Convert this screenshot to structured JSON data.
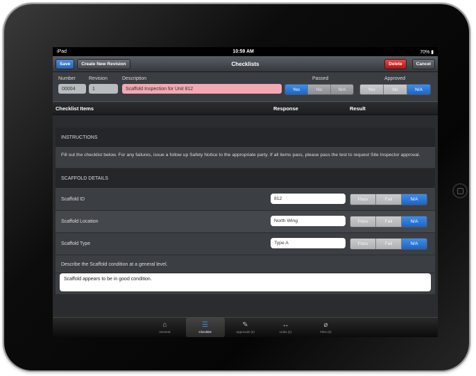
{
  "status_bar": {
    "carrier": "iPad",
    "time": "10:59 AM",
    "battery": "70%"
  },
  "nav": {
    "save_label": "Save",
    "create_revision_label": "Create New Revision",
    "title": "Checklists",
    "delete_label": "Delete",
    "cancel_label": "Cancel"
  },
  "header": {
    "number_label": "Number",
    "revision_label": "Revision",
    "description_label": "Description",
    "passed_label": "Passed",
    "approved_label": "Approved",
    "number_value": "00004",
    "revision_value": "1",
    "description_value": "Scaffold Inspection for Unit 812",
    "passed_options": [
      "Yes",
      "No",
      "N/A"
    ],
    "passed_selected": "Yes",
    "approved_options": [
      "Yes",
      "No",
      "N/A"
    ],
    "approved_selected": "N/A"
  },
  "columns": {
    "items": "Checklist Items",
    "response": "Response",
    "result": "Result"
  },
  "instructions": {
    "heading": "INSTRUCTIONS",
    "text": "Fill out the checklist below. For any failures, issue a follow up Safety Notice to the appropriate party. If all items pass, please pass the test to request Site Inspector approval."
  },
  "scaffold_section": {
    "heading": "SCAFFOLD DETAILS",
    "items": [
      {
        "name": "Scaffold ID",
        "value": "812",
        "options": [
          "Pass",
          "Fail",
          "N/A"
        ],
        "selected": "N/A"
      },
      {
        "name": "Scaffold Location",
        "value": "North Wing",
        "options": [
          "Pass",
          "Fail",
          "N/A"
        ],
        "selected": "N/A"
      },
      {
        "name": "Scaffold Type",
        "value": "Type A",
        "options": [
          "Pass",
          "Fail",
          "N/A"
        ],
        "selected": "N/A"
      }
    ],
    "describe_prompt": "Describe the Scaffold condition at a general level.",
    "describe_value": "Scaffold appears to be in good condition."
  },
  "tabs": [
    {
      "label": "General",
      "icon": "home-icon"
    },
    {
      "label": "Checklist",
      "icon": "list-icon",
      "active": true
    },
    {
      "label": "Approvals (2)",
      "icon": "pencil-icon"
    },
    {
      "label": "Links (1)",
      "icon": "arrows-icon"
    },
    {
      "label": "Files (0)",
      "icon": "paperclip-icon"
    }
  ],
  "colors": {
    "accent": "#2b76d4",
    "delete": "#cc2222",
    "description_bg": "#f3a9b3"
  }
}
